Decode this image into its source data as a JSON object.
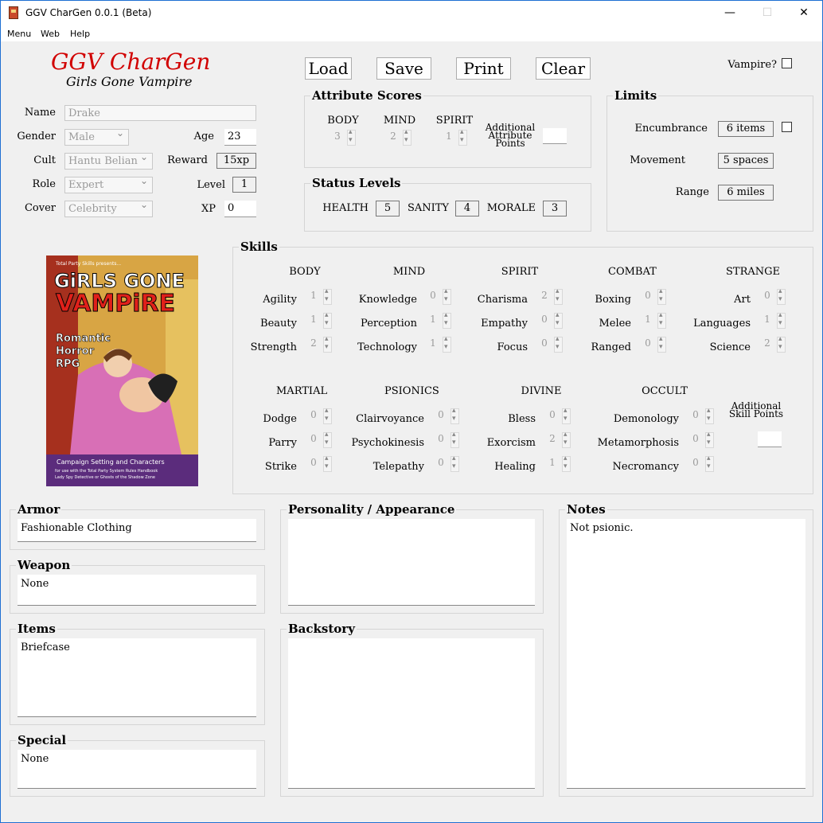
{
  "window": {
    "title": "GGV CharGen 0.0.1 (Beta)",
    "minimize": "—",
    "maximize": "☐",
    "close": "✕"
  },
  "menu": [
    "Menu",
    "Web",
    "Help"
  ],
  "logo": {
    "title": "GGV CharGen",
    "subtitle": "Girls Gone Vampire"
  },
  "toolbar": {
    "load": "Load",
    "save": "Save",
    "print": "Print",
    "clear": "Clear",
    "vampire_label": "Vampire?"
  },
  "character": {
    "name_label": "Name",
    "name": "Drake",
    "gender_label": "Gender",
    "gender": "Male",
    "age_label": "Age",
    "age": "23",
    "cult_label": "Cult",
    "cult": "Hantu Belian",
    "reward_label": "Reward",
    "reward": "15xp",
    "role_label": "Role",
    "role": "Expert",
    "level_label": "Level",
    "level": "1",
    "cover_label": "Cover",
    "cover": "Celebrity",
    "xp_label": "XP",
    "xp": "0"
  },
  "attributes": {
    "title": "Attribute Scores",
    "body_label": "BODY",
    "body": "3",
    "mind_label": "MIND",
    "mind": "2",
    "spirit_label": "SPIRIT",
    "spirit": "1",
    "additional_label": "Additional Attribute Points"
  },
  "status": {
    "title": "Status Levels",
    "health_label": "HEALTH",
    "health": "5",
    "sanity_label": "SANITY",
    "sanity": "4",
    "morale_label": "MORALE",
    "morale": "3"
  },
  "limits": {
    "title": "Limits",
    "encumbrance_label": "Encumbrance",
    "encumbrance": "6 items",
    "movement_label": "Movement",
    "movement": "5 spaces",
    "range_label": "Range",
    "range": "6 miles"
  },
  "skills": {
    "title": "Skills",
    "additional_label": "Additional Skill Points",
    "groups": [
      {
        "name": "BODY",
        "skills": [
          {
            "label": "Agility",
            "value": "1"
          },
          {
            "label": "Beauty",
            "value": "1"
          },
          {
            "label": "Strength",
            "value": "2"
          }
        ]
      },
      {
        "name": "MIND",
        "skills": [
          {
            "label": "Knowledge",
            "value": "0"
          },
          {
            "label": "Perception",
            "value": "1"
          },
          {
            "label": "Technology",
            "value": "1"
          }
        ]
      },
      {
        "name": "SPIRIT",
        "skills": [
          {
            "label": "Charisma",
            "value": "2"
          },
          {
            "label": "Empathy",
            "value": "0"
          },
          {
            "label": "Focus",
            "value": "0"
          }
        ]
      },
      {
        "name": "COMBAT",
        "skills": [
          {
            "label": "Boxing",
            "value": "0"
          },
          {
            "label": "Melee",
            "value": "1"
          },
          {
            "label": "Ranged",
            "value": "0"
          }
        ]
      },
      {
        "name": "STRANGE",
        "skills": [
          {
            "label": "Art",
            "value": "0"
          },
          {
            "label": "Languages",
            "value": "1"
          },
          {
            "label": "Science",
            "value": "2"
          }
        ]
      },
      {
        "name": "MARTIAL",
        "skills": [
          {
            "label": "Dodge",
            "value": "0"
          },
          {
            "label": "Parry",
            "value": "0"
          },
          {
            "label": "Strike",
            "value": "0"
          }
        ]
      },
      {
        "name": "PSIONICS",
        "skills": [
          {
            "label": "Clairvoyance",
            "value": "0"
          },
          {
            "label": "Psychokinesis",
            "value": "0"
          },
          {
            "label": "Telepathy",
            "value": "0"
          }
        ]
      },
      {
        "name": "DIVINE",
        "skills": [
          {
            "label": "Bless",
            "value": "0"
          },
          {
            "label": "Exorcism",
            "value": "2"
          },
          {
            "label": "Healing",
            "value": "1"
          }
        ]
      },
      {
        "name": "OCCULT",
        "skills": [
          {
            "label": "Demonology",
            "value": "0"
          },
          {
            "label": "Metamorphosis",
            "value": "0"
          },
          {
            "label": "Necromancy",
            "value": "0"
          }
        ]
      }
    ]
  },
  "cover_art": {
    "presents": "Total Party Skills presents...",
    "title1": "GiRLS GONE",
    "title2": "VAMPiRE",
    "tag1": "Romantic",
    "tag2": "Horror",
    "tag3": "RPG",
    "footer1": "Campaign Setting and Characters",
    "footer2": "for use with the Total Party System Rules Handbook",
    "footer3": "Lady Spy Detective or Ghosts of the Shadow Zone"
  },
  "panels": {
    "armor_label": "Armor",
    "armor": "Fashionable Clothing",
    "weapon_label": "Weapon",
    "weapon": "None",
    "items_label": "Items",
    "items": "Briefcase",
    "special_label": "Special",
    "special": "None",
    "personality_label": "Personality / Appearance",
    "personality": "",
    "backstory_label": "Backstory",
    "backstory": "",
    "notes_label": "Notes",
    "notes": "Not psionic."
  }
}
